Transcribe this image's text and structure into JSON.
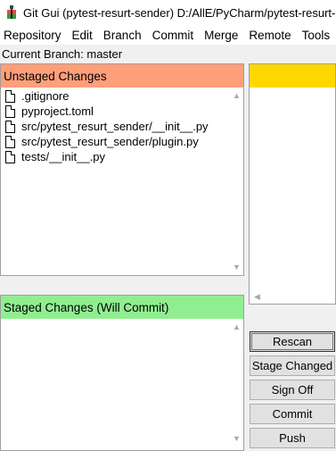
{
  "window": {
    "title": "Git Gui (pytest-resurt-sender) D:/AllE/PyCharm/pytest-resurt-",
    "icon": "git-icon"
  },
  "menu": [
    "Repository",
    "Edit",
    "Branch",
    "Commit",
    "Merge",
    "Remote",
    "Tools"
  ],
  "branch_line": "Current Branch: master",
  "unstaged": {
    "header": "Unstaged Changes",
    "color": "#ff9f7a",
    "files": [
      ".gitignore",
      "pyproject.toml",
      "src/pytest_resurt_sender/__init__.py",
      "src/pytest_resurt_sender/plugin.py",
      "tests/__init__.py"
    ]
  },
  "staged": {
    "header": "Staged Changes (Will Commit)",
    "color": "#90ee90",
    "files": []
  },
  "diff": {
    "header_color": "#ffd700"
  },
  "buttons": {
    "rescan": "Rescan",
    "stage_changed": "Stage Changed",
    "sign_off": "Sign Off",
    "commit": "Commit",
    "push": "Push"
  }
}
